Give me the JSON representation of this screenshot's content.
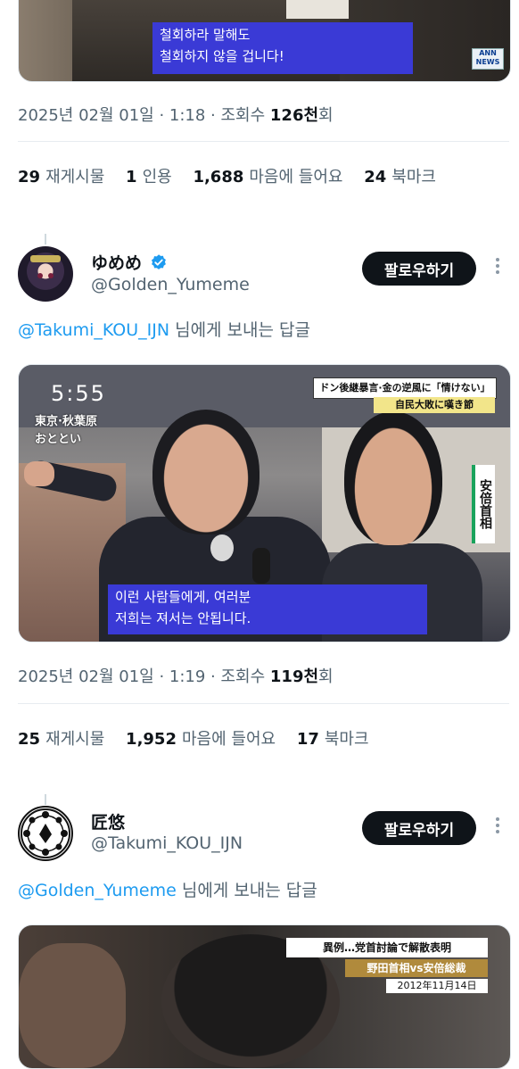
{
  "tweet1": {
    "media": {
      "subtitle_line1": "철회하라 말해도",
      "subtitle_line2": "철회하지 않을 겁니다!",
      "watermark_top": "ANN",
      "watermark_bottom": "NEWS"
    },
    "meta": {
      "date": "2025년 02월 01일 · 1:18 · 조회수 ",
      "views": "126천",
      "views_suffix": "회"
    },
    "stats": [
      {
        "num": "29",
        "label": "재게시물"
      },
      {
        "num": "1",
        "label": "인용"
      },
      {
        "num": "1,688",
        "label": "마음에 들어요"
      },
      {
        "num": "24",
        "label": "북마크"
      }
    ]
  },
  "tweet2": {
    "user": {
      "name": "ゆめめ",
      "handle": "@Golden_Yumeme",
      "verified": true
    },
    "follow_label": "팔로우하기",
    "reply": {
      "mention": "@Takumi_KOU_IJN",
      "text": " 님에게 보내는 답글"
    },
    "media": {
      "time": "5:55",
      "location": "東京·秋葉原",
      "day": "おととい",
      "headline": "ドン後継暴言·金の逆風に「情けない」",
      "headline2": "自民大敗に嘆き節",
      "name_tag": "安倍首相",
      "subtitle_line1": "이런 사람들에게, 여러분",
      "subtitle_line2": "저희는 져서는 안됩니다."
    },
    "meta": {
      "date": "2025년 02월 01일 · 1:19 · 조회수 ",
      "views": "119천",
      "views_suffix": "회"
    },
    "stats": [
      {
        "num": "25",
        "label": "재게시물"
      },
      {
        "num": "1,952",
        "label": "마음에 들어요"
      },
      {
        "num": "17",
        "label": "북마크"
      }
    ]
  },
  "tweet3": {
    "user": {
      "name": "匠悠",
      "handle": "@Takumi_KOU_IJN"
    },
    "follow_label": "팔로우하기",
    "reply": {
      "mention": "@Golden_Yumeme",
      "text": " 님에게 보내는 답글"
    },
    "media": {
      "headline1": "異例…党首討論で解散表明",
      "headline2": "野田首相vs安倍総裁",
      "date": "2012年11月14日"
    }
  },
  "icons": {
    "verified": "verified-badge-icon",
    "more": "more-vertical-icon"
  },
  "colors": {
    "link": "#1d9bf0",
    "secondary_text": "#536471",
    "follow_button": "#0f1419",
    "subtitle_bg": "#3a3ad6"
  }
}
